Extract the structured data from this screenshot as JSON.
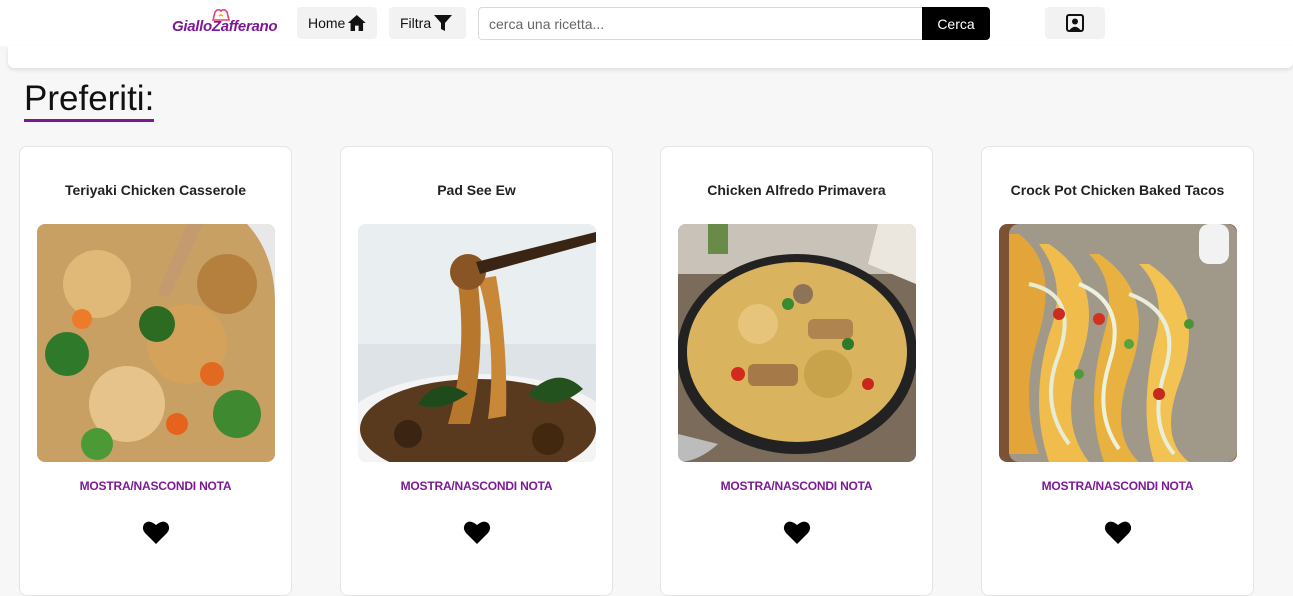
{
  "header": {
    "logo_text": "GialloZafferano",
    "home_label": "Home",
    "home_icon": "home-icon",
    "filter_label": "Filtra",
    "filter_icon": "filter-icon",
    "search_placeholder": "cerca una ricetta...",
    "search_value": "",
    "search_button_label": "Cerca",
    "profile_icon": "profile-icon"
  },
  "colors": {
    "brand": "#7c1a96",
    "search_button": "#000000"
  },
  "page": {
    "title": "Preferiti:"
  },
  "recipes": [
    {
      "title": "Teriyaki Chicken Casserole",
      "toggle_note_label": "MOSTRA/NASCONDI NOTA",
      "favorite": true
    },
    {
      "title": "Pad See Ew",
      "toggle_note_label": "MOSTRA/NASCONDI NOTA",
      "favorite": true
    },
    {
      "title": "Chicken Alfredo Primavera",
      "toggle_note_label": "MOSTRA/NASCONDI NOTA",
      "favorite": true
    },
    {
      "title": "Crock Pot Chicken Baked Tacos",
      "toggle_note_label": "MOSTRA/NASCONDI NOTA",
      "favorite": true
    }
  ]
}
